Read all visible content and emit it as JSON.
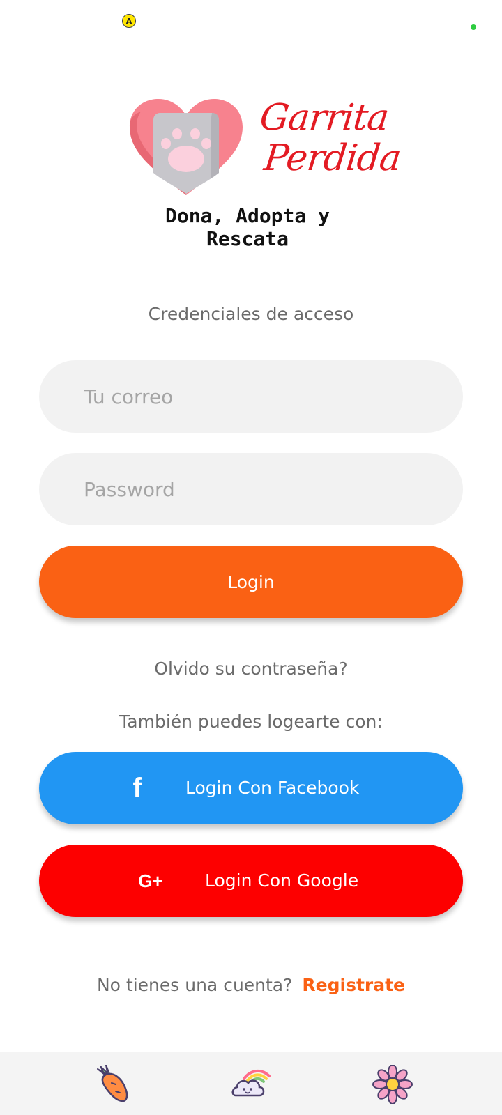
{
  "status_bar": {
    "indicator_letter": "A"
  },
  "logo": {
    "name_line1": "Garrita",
    "name_line2": "Perdida",
    "tagline": "Dona, Adopta y Rescata"
  },
  "form": {
    "heading": "Credenciales de acceso",
    "email_placeholder": "Tu correo",
    "password_placeholder": "Password",
    "login_label": "Login",
    "forgot_label": "Olvido su contraseña?"
  },
  "social": {
    "heading": "También puedes logearte con:",
    "facebook_label": "Login Con Facebook",
    "facebook_icon": "f",
    "google_label": "Login Con Google",
    "google_icon": "G+"
  },
  "signup": {
    "question": "No tienes una cuenta?",
    "link_label": "Registrate"
  },
  "bottom_nav": {
    "items": [
      {
        "icon": "carrot-icon"
      },
      {
        "icon": "rainbow-cloud-icon"
      },
      {
        "icon": "flower-icon"
      }
    ]
  },
  "colors": {
    "accent": "#fa6114",
    "facebook": "#2196f3",
    "google": "#fd0000",
    "brand_red": "#e31b23"
  }
}
